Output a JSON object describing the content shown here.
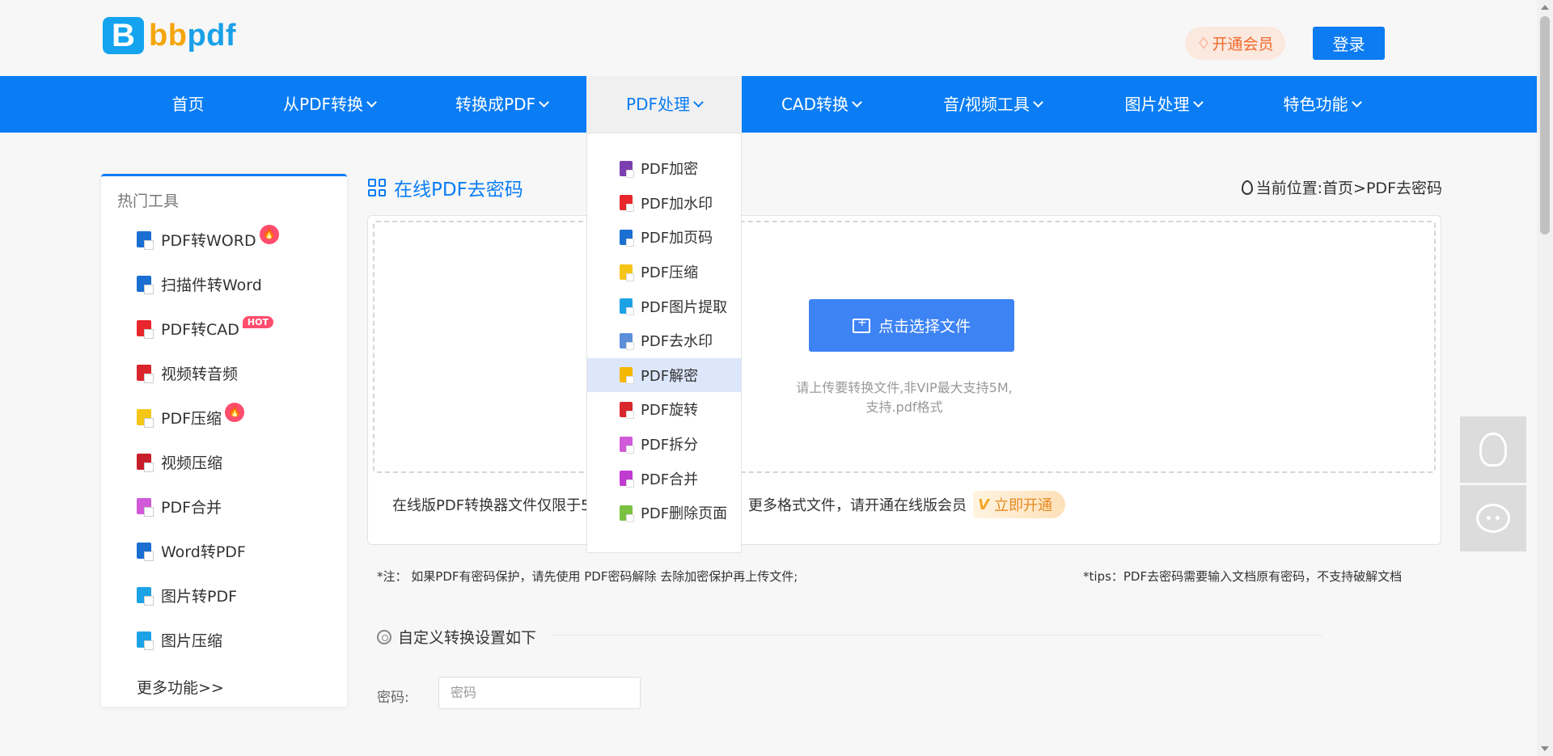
{
  "header": {
    "logo_letter": "B",
    "logo_text_part1": "bb",
    "logo_text_part2": "pdf",
    "vip_label": "开通会员",
    "login_label": "登录"
  },
  "nav": {
    "items": [
      {
        "label": "首页"
      },
      {
        "label": "从PDF转换"
      },
      {
        "label": "转换成PDF"
      },
      {
        "label": "PDF处理"
      },
      {
        "label": "CAD转换"
      },
      {
        "label": "音/视频工具"
      },
      {
        "label": "图片处理"
      },
      {
        "label": "特色功能"
      }
    ]
  },
  "dropdown": {
    "items": [
      {
        "label": "PDF加密",
        "color": "#7b3fb0"
      },
      {
        "label": "PDF加水印",
        "color": "#e8262c"
      },
      {
        "label": "PDF加页码",
        "color": "#1a6fd1"
      },
      {
        "label": "PDF压缩",
        "color": "#f5c518"
      },
      {
        "label": "PDF图片提取",
        "color": "#1da2e6"
      },
      {
        "label": "PDF去水印",
        "color": "#5b8fd9"
      },
      {
        "label": "PDF解密",
        "color": "#f5b800"
      },
      {
        "label": "PDF旋转",
        "color": "#d9262c"
      },
      {
        "label": "PDF拆分",
        "color": "#d05ad8"
      },
      {
        "label": "PDF合并",
        "color": "#c03cd0"
      },
      {
        "label": "PDF删除页面",
        "color": "#7ac142"
      }
    ],
    "highlighted_index": 6
  },
  "sidebar": {
    "title": "热门工具",
    "items": [
      {
        "label": "PDF转WORD",
        "color": "#1a6fd1",
        "badge": "fire"
      },
      {
        "label": "扫描件转Word",
        "color": "#1a6fd1",
        "badge": ""
      },
      {
        "label": "PDF转CAD",
        "color": "#e8262c",
        "badge": "HOT"
      },
      {
        "label": "视频转音频",
        "color": "#d9262c",
        "badge": ""
      },
      {
        "label": "PDF压缩",
        "color": "#f5c518",
        "badge": "fire"
      },
      {
        "label": "视频压缩",
        "color": "#c81e2a",
        "badge": ""
      },
      {
        "label": "PDF合并",
        "color": "#d05ad8",
        "badge": ""
      },
      {
        "label": "Word转PDF",
        "color": "#1a6fd1",
        "badge": ""
      },
      {
        "label": "图片转PDF",
        "color": "#1da2e6",
        "badge": ""
      },
      {
        "label": "图片压缩",
        "color": "#1da2e6",
        "badge": ""
      }
    ],
    "hot_label": "HOT",
    "more_label": "更多功能>>"
  },
  "main": {
    "title": "在线PDF去密码",
    "breadcrumb": "当前位置:首页>PDF去密码",
    "choose_file_label": "点击选择文件",
    "upload_hint_line1": "请上传要转换文件,非VIP最大支持5M,",
    "upload_hint_line2": "支持.pdf格式",
    "notice_text": "在线版PDF转换器文件仅限于5M，如需转换更大文件、更多格式文件，请开通在线版会员",
    "vip_open_label": "立即开通",
    "note_left": "*注： 如果PDF有密码保护，请先使用 PDF密码解除 去除加密保护再上传文件;",
    "note_right": "*tips：PDF去密码需要输入文档原有密码，不支持破解文档",
    "custom_title": "自定义转换设置如下",
    "password_label": "密码:",
    "password_placeholder": "密码"
  },
  "colors": {
    "brand_blue": "#0a7df5",
    "button_blue": "#3d83f4",
    "vip_orange": "#f06a2c"
  }
}
